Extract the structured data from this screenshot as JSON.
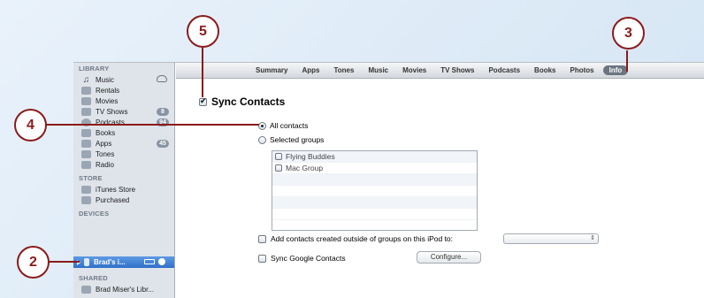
{
  "sidebar": {
    "library_header": "LIBRARY",
    "library_items": [
      {
        "label": "Music",
        "icon": "music-note-icon"
      },
      {
        "label": "Rentals",
        "icon": "film-icon"
      },
      {
        "label": "Movies",
        "icon": "film-icon"
      },
      {
        "label": "TV Shows",
        "icon": "tv-icon",
        "count": "8"
      },
      {
        "label": "Podcasts",
        "icon": "podcast-icon",
        "count": "94"
      },
      {
        "label": "Books",
        "icon": "book-icon"
      },
      {
        "label": "Apps",
        "icon": "apps-icon",
        "count": "45"
      },
      {
        "label": "Tones",
        "icon": "bell-icon"
      },
      {
        "label": "Radio",
        "icon": "radio-icon"
      }
    ],
    "store_header": "STORE",
    "store_items": [
      {
        "label": "iTunes Store",
        "icon": "store-icon"
      },
      {
        "label": "Purchased",
        "icon": "purchased-icon"
      }
    ],
    "devices_header": "DEVICES",
    "device": {
      "label": "Brad's i..."
    },
    "shared_header": "SHARED",
    "shared_items": [
      {
        "label": "Brad Miser's Libr..."
      }
    ]
  },
  "tabs": [
    "Summary",
    "Apps",
    "Tones",
    "Music",
    "Movies",
    "TV Shows",
    "Podcasts",
    "Books",
    "Photos",
    "Info"
  ],
  "active_tab": "Info",
  "content": {
    "sync_title": "Sync Contacts",
    "all_contacts": "All contacts",
    "selected_groups": "Selected groups",
    "groups": [
      "Flying Buddies",
      "Mac Group"
    ],
    "add_contacts_label": "Add contacts created outside of groups on this iPod to:",
    "dropdown_value": "",
    "sync_google": "Sync Google Contacts",
    "configure_button": "Configure..."
  },
  "callouts": [
    "2",
    "3",
    "4",
    "5"
  ],
  "colors": {
    "callout": "#8b1a1a",
    "selection": "#3b7bd3"
  }
}
